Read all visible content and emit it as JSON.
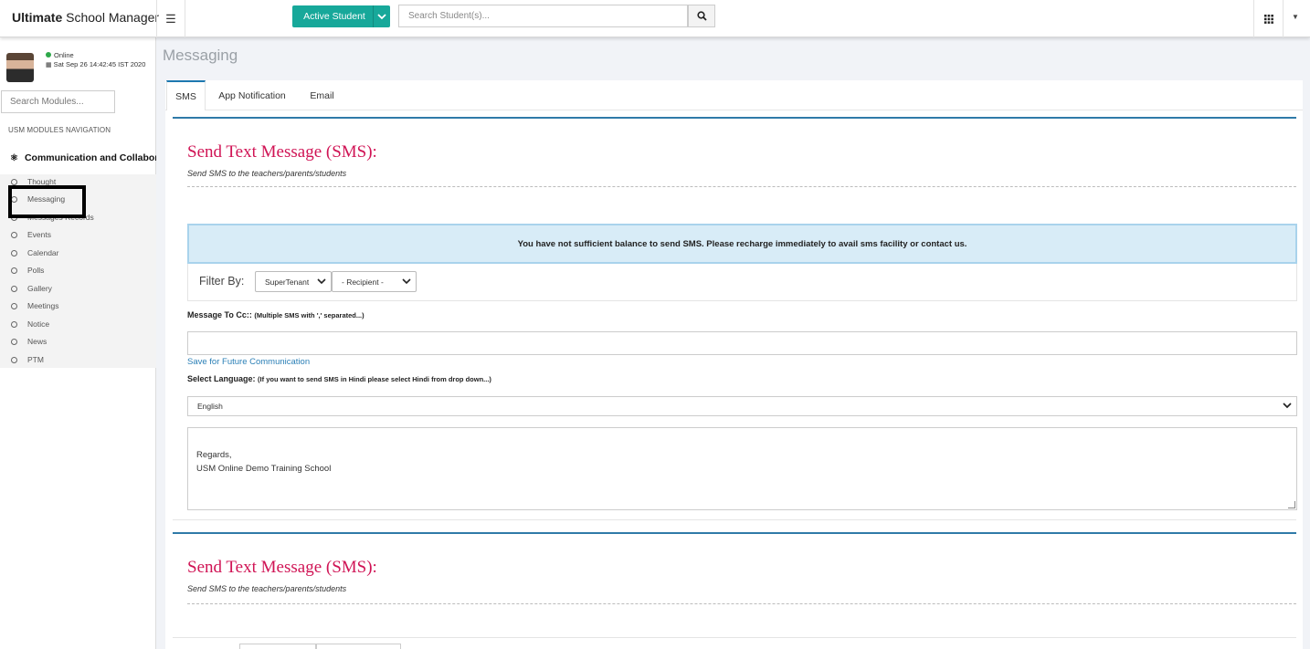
{
  "topbar": {
    "brand_bold": "Ultimate",
    "brand_rest": " School Manager",
    "active_student_label": "Active Student",
    "search_placeholder": "Search Student(s)..."
  },
  "sidebar": {
    "status": "Online",
    "datetime": "Sat Sep 26 14:42:45 IST 2020",
    "search_placeholder": "Search Modules...",
    "nav_heading": "USM MODULES NAVIGATION",
    "group_title": "Communication and Collaboration",
    "items": [
      {
        "label": "Thought"
      },
      {
        "label": "Messaging"
      },
      {
        "label": "Messages Records"
      },
      {
        "label": "Events"
      },
      {
        "label": "Calendar"
      },
      {
        "label": "Polls"
      },
      {
        "label": "Gallery"
      },
      {
        "label": "Meetings"
      },
      {
        "label": "Notice"
      },
      {
        "label": "News"
      },
      {
        "label": "PTM"
      }
    ]
  },
  "main": {
    "page_title": "Messaging",
    "tabs": [
      {
        "label": "SMS"
      },
      {
        "label": "App Notification"
      },
      {
        "label": "Email"
      }
    ],
    "sms": {
      "title": "Send Text Message (SMS):",
      "subtitle": "Send SMS to the teachers/parents/students",
      "alert": "You have not sufficient balance to send SMS. Please recharge immediately to avail sms facility or contact us.",
      "filter_label": "Filter By:",
      "filter_tenant": "SuperTenant",
      "filter_recipient": "- Recipient -",
      "cc_label": "Message To Cc::",
      "cc_hint": "(Multiple SMS with ',' separated...)",
      "save_link": "Save for Future Communication",
      "language_label": "Select Language:",
      "language_hint": "(If you want to send SMS in Hindi please select Hindi from drop down...)",
      "language_value": "English",
      "message_line1": "Regards,",
      "message_line2": "USM Online Demo Training School"
    },
    "sms2": {
      "title": "Send Text Message (SMS):",
      "subtitle": "Send SMS to the teachers/parents/students"
    }
  }
}
